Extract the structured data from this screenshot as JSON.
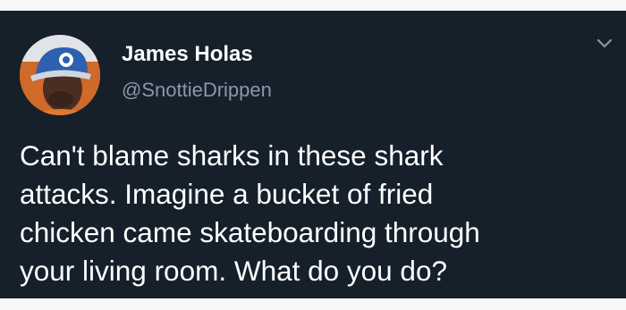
{
  "tweet": {
    "author": {
      "display_name": "James Holas",
      "handle": "@SnottieDrippen",
      "avatar_icon": "user-avatar"
    },
    "menu_icon": "chevron-down-icon",
    "text_lines": [
      "Can't blame sharks in these shark",
      "attacks. Imagine a bucket of fried",
      "chicken came skateboarding through",
      "your living room. What do you do?"
    ]
  },
  "colors": {
    "card_background": "#15202b",
    "name_text": "#ffffff",
    "handle_text": "#8899a6",
    "body_text": "#ffffff"
  }
}
